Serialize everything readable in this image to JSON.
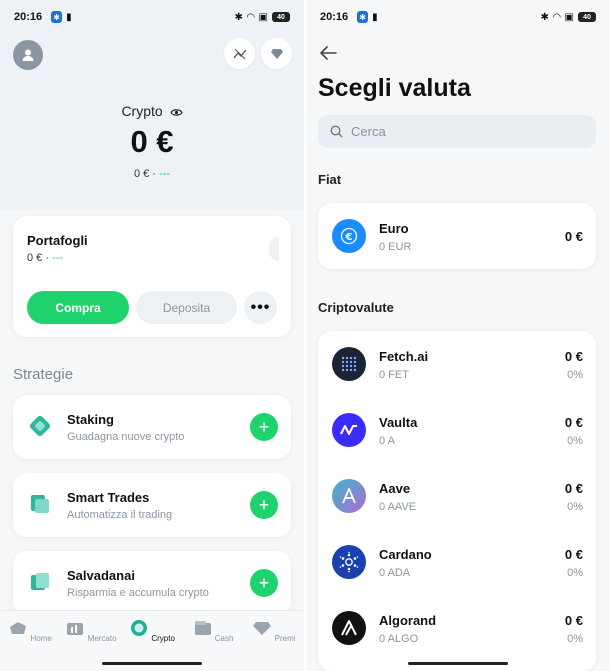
{
  "status_bar": {
    "time": "20:16",
    "battery": "40"
  },
  "left": {
    "balance_label": "Crypto",
    "balance": "0 €",
    "balance_sub": "0 € · ",
    "balance_sub_change": "---",
    "wallet": {
      "title": "Portafogli",
      "value": "0 € · ",
      "change": "---",
      "buy_label": "Compra",
      "deposit_label": "Deposita",
      "more_label": "•••"
    },
    "strategies_title": "Strategie",
    "strategies": [
      {
        "title": "Staking",
        "subtitle": "Guadagna nuove crypto"
      },
      {
        "title": "Smart Trades",
        "subtitle": "Automatizza il trading"
      },
      {
        "title": "Salvadanai",
        "subtitle": "Risparmia e accumula crypto"
      }
    ],
    "tabs": [
      {
        "label": "Home",
        "icon": "home-icon"
      },
      {
        "label": "Mercato",
        "icon": "market-icon"
      },
      {
        "label": "Crypto",
        "icon": "crypto-icon"
      },
      {
        "label": "Cash",
        "icon": "cash-icon"
      },
      {
        "label": "Premi",
        "icon": "rewards-icon"
      }
    ]
  },
  "right": {
    "title": "Scegli valuta",
    "search_placeholder": "Cerca",
    "fiat_title": "Fiat",
    "fiat": [
      {
        "name": "Euro",
        "amount": "0 EUR",
        "value": "0 €",
        "color": "#1a8cff"
      }
    ],
    "crypto_title": "Criptovalute",
    "crypto": [
      {
        "name": "Fetch.ai",
        "amount": "0 FET",
        "value": "0 €",
        "pct": "0%",
        "color": "#1b2435"
      },
      {
        "name": "Vaulta",
        "amount": "0 A",
        "value": "0 €",
        "pct": "0%",
        "color": "#3a2bff"
      },
      {
        "name": "Aave",
        "amount": "0 AAVE",
        "value": "0 €",
        "pct": "0%",
        "color": "#9a6fd0"
      },
      {
        "name": "Cardano",
        "amount": "0 ADA",
        "value": "0 €",
        "pct": "0%",
        "color": "#1a3fb0"
      },
      {
        "name": "Algorand",
        "amount": "0 ALGO",
        "value": "0 €",
        "pct": "0%",
        "color": "#111111"
      }
    ]
  }
}
